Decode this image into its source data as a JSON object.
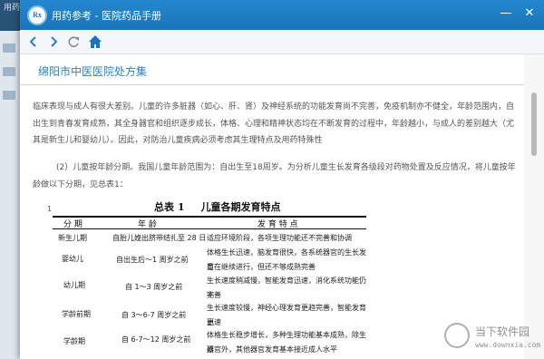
{
  "background_app": {
    "title": "用药参考"
  },
  "window": {
    "title": "用药参考 - 医院药品手册",
    "icon_text": "Rx",
    "controls": {
      "minimize": "—",
      "close": "✕"
    }
  },
  "nav": {
    "back_icon": "chevron-left-icon",
    "forward_icon": "chevron-right-icon",
    "refresh_icon": "refresh-icon",
    "home_icon": "home-icon"
  },
  "document": {
    "hospital_title": "绵阳市中医医院处方集",
    "paragraph1": "临床表现与成人有很大差别。儿童的许多脏器（如心、肝、肾）及神经系统的功能发育尚不完善，免疫机制亦不健全，年龄范围内，自出生到青春发育成熟，其全身器官和组织逐步成长，体格、心理和精神状态均在不断发育的过程中，年龄越小，与成人的差别越大（尤其是新生儿和婴幼儿）。因此，对防治儿童疾病必须考虑其生理特点及用药特殊性",
    "paragraph2": "(2）儿童按年龄分期。我国儿童年龄范围为：自出生至18周岁。为分析儿童生长发育各级段对药物处置及反应情况，将儿童按年龄做以下分期，见总表1：",
    "table": {
      "title_prefix": "总表 1",
      "title_main": "儿童各期发育特点",
      "mark": "1",
      "headers": [
        "分  期",
        "年  龄",
        "发  育  特  点"
      ],
      "rows": [
        {
          "period": "新生儿期",
          "age": "自胎儿娩出脐带结扎至 28 日",
          "features": [
            "适应环境阶段，各项生理功能还不完善和协调"
          ]
        },
        {
          "period": "婴幼儿",
          "age": "自出生后～1 周岁之前",
          "features": [
            "体格生长迅速，脑发育很快，各系统器官的生长发育",
            "虽在继续进行，但还不够成熟完善"
          ]
        },
        {
          "period": "幼儿期",
          "age": "自 1～3 周岁之前",
          "features": [
            "生长速度稍减慢，智能发育迅速，消化系统功能仍不",
            "完善"
          ]
        },
        {
          "period": "学龄前期",
          "age": "自 3～6-7 周岁之前",
          "features": [
            "生长速度较慢，神经心理发育更趋完善，智能发育更",
            "迅速"
          ]
        },
        {
          "period": "学龄期",
          "age": "自 6-7～12 周岁之前",
          "features": [
            "体格生长稳步增长，多种生理功能基本成熟，除生殖",
            "器官外，其他器官发育基本接近成人水平"
          ]
        }
      ]
    }
  },
  "watermark": {
    "title": "当下软件园",
    "url": "www.downxia.com"
  },
  "colors": {
    "titlebar": "#1b74b8",
    "accent_text": "#2a82c4"
  }
}
